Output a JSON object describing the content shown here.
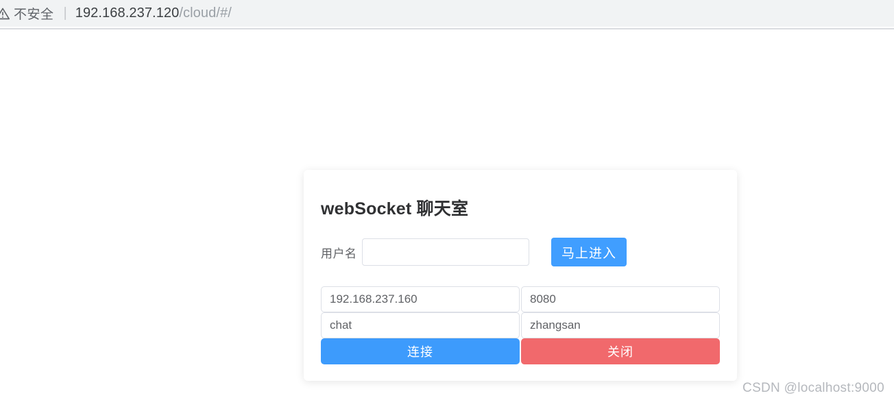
{
  "browser": {
    "security_icon": "warning-triangle-icon",
    "security_label": "不安全",
    "separator": "|",
    "url_host": "192.168.237.120",
    "url_path": "/cloud/#/"
  },
  "card": {
    "title": "webSocket 聊天室",
    "username_row": {
      "label": "用户名",
      "input_value": "",
      "input_placeholder": "",
      "button_label": "马上进入"
    },
    "connection_fields": [
      {
        "name": "host",
        "value": "192.168.237.160"
      },
      {
        "name": "port",
        "value": "8080"
      },
      {
        "name": "topic",
        "value": "chat"
      },
      {
        "name": "username",
        "value": "zhangsan"
      }
    ],
    "actions": [
      {
        "name": "connect",
        "label": "连接",
        "color": "#3d9bfc"
      },
      {
        "name": "close",
        "label": "关闭",
        "color": "#f1696c"
      }
    ]
  },
  "watermark": {
    "text": "CSDN @localhost:9000"
  },
  "colors": {
    "primary": "#409eff",
    "danger": "#f1696c",
    "toolbar_bg": "#f1f3f4",
    "border": "#dcdfe6",
    "title_text": "#303133",
    "body_text": "#606266"
  }
}
